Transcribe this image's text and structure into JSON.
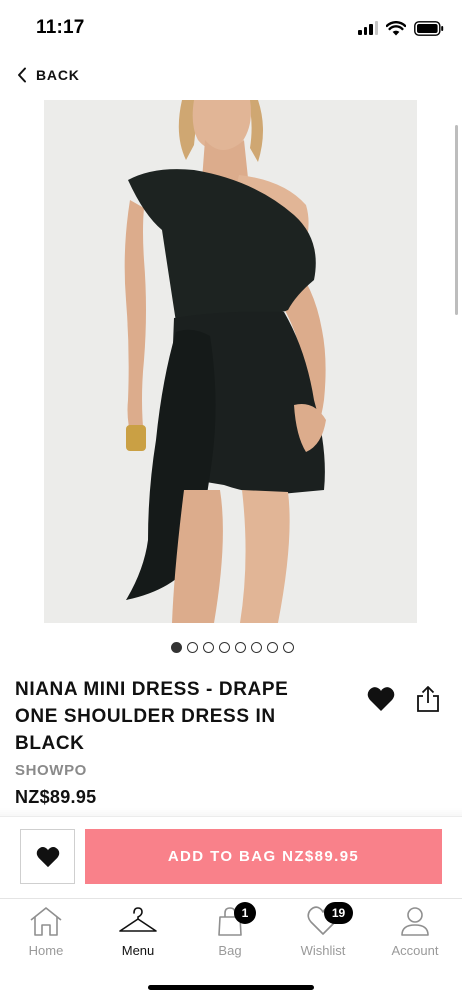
{
  "status_bar": {
    "time": "11:17"
  },
  "nav": {
    "back_label": "BACK"
  },
  "product": {
    "title": "NIANA MINI DRESS - DRAPE ONE SHOULDER DRESS IN BLACK",
    "brand": "SHOWPO",
    "price": "NZ$89.95",
    "image_alt": "Model wearing black one shoulder draped mini dress"
  },
  "carousel": {
    "total_images": 8,
    "active_index": 0
  },
  "actions": {
    "add_to_bag_label": "ADD TO BAG NZ$89.95"
  },
  "tab_bar": {
    "items": [
      {
        "label": "Home",
        "icon": "home-icon",
        "active": false
      },
      {
        "label": "Menu",
        "icon": "hanger-icon",
        "active": true
      },
      {
        "label": "Bag",
        "icon": "bag-icon",
        "active": false,
        "badge": "1"
      },
      {
        "label": "Wishlist",
        "icon": "heart-outline-icon",
        "active": false,
        "badge": "19"
      },
      {
        "label": "Account",
        "icon": "person-icon",
        "active": false
      }
    ]
  },
  "colors": {
    "accent": "#f9818a",
    "text": "#111111",
    "muted": "#8a8a8a",
    "image_bg": "#ececea"
  }
}
